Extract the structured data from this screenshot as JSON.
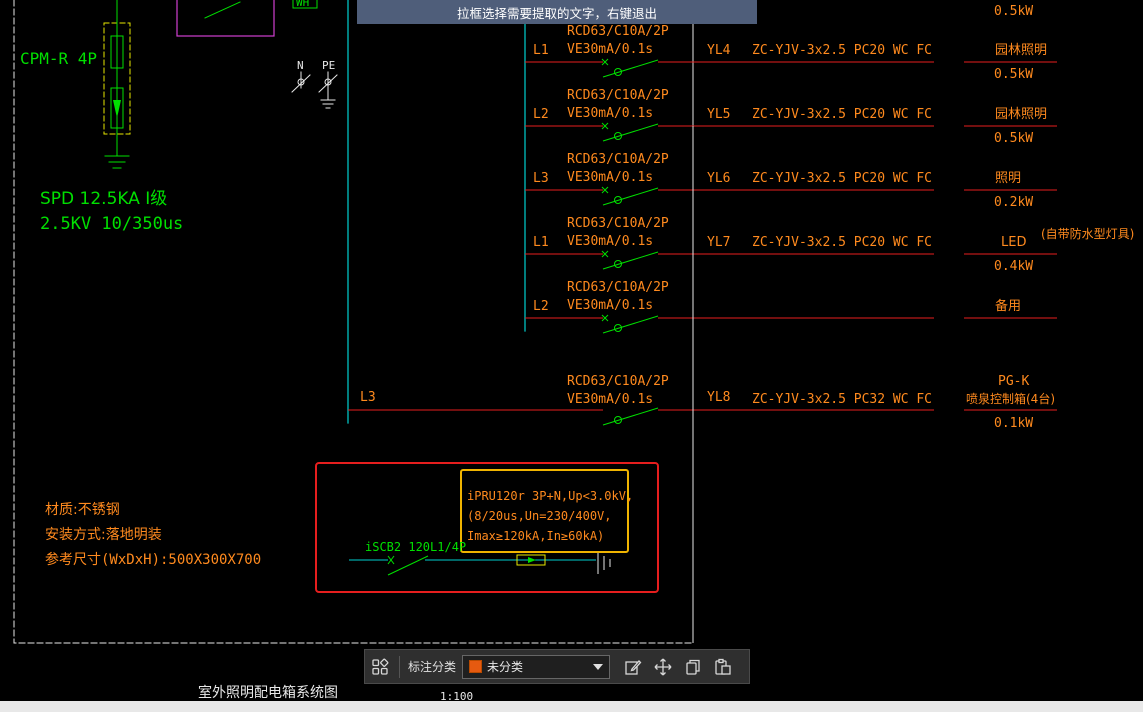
{
  "hint_bar": {
    "text": "拉框选择需要提取的文字，右键退出",
    "bg": "#4f5e7a"
  },
  "colors": {
    "green": "#00e000",
    "orange": "#ff8a1e",
    "red_line": "#e61e1e",
    "cyan_bus": "#00d0d0",
    "annot_red": "#e61e1e",
    "annot_yellow": "#f0b400",
    "category_swatch": "#e65a10"
  },
  "left": {
    "cpm": "CPM-R 4P",
    "spd_line1": "SPD 12.5KA I级",
    "spd_line2": "2.5KV 10/350us",
    "wh": "WH",
    "n": "N",
    "pe": "PE",
    "material": "材质:不锈钢",
    "install": "安装方式:落地明装",
    "size": "参考尺寸(WxDxH):500X300X700"
  },
  "top_power": "0.5kW",
  "circuits": [
    {
      "breaker1": "RCD63/C10A/2P",
      "breaker2": "VE30mA/0.1s",
      "phase": "L1",
      "id": "YL4",
      "cable": "ZC-YJV-3x2.5 PC20 WC FC",
      "load": "园林照明",
      "power": "0.5kW"
    },
    {
      "breaker1": "RCD63/C10A/2P",
      "breaker2": "VE30mA/0.1s",
      "phase": "L2",
      "id": "YL5",
      "cable": "ZC-YJV-3x2.5 PC20 WC FC",
      "load": "园林照明",
      "power": "0.5kW"
    },
    {
      "breaker1": "RCD63/C10A/2P",
      "breaker2": "VE30mA/0.1s",
      "phase": "L3",
      "id": "YL6",
      "cable": "ZC-YJV-3x2.5 PC20 WC FC",
      "load": "照明",
      "power": "0.2kW"
    },
    {
      "breaker1": "RCD63/C10A/2P",
      "breaker2": "VE30mA/0.1s",
      "phase": "L1",
      "id": "YL7",
      "cable": "ZC-YJV-3x2.5 PC20 WC FC",
      "load": "LED",
      "load_note": "(自带防水型灯具)",
      "power": "0.4kW"
    },
    {
      "breaker1": "RCD63/C10A/2P",
      "breaker2": "VE30mA/0.1s",
      "phase": "L2",
      "id": "",
      "cable": "",
      "load": "备用",
      "power": ""
    }
  ],
  "circuit_l3": {
    "breaker1": "RCD63/C10A/2P",
    "breaker2": "VE30mA/0.1s",
    "phase": "L3",
    "id": "YL8",
    "cable": "ZC-YJV-3x2.5 PC32 WC FC",
    "load1": "PG-K",
    "load2": "喷泉控制箱(4台)",
    "power": "0.1kW"
  },
  "spd_device": {
    "breaker": "iSCB2 120L1/4P",
    "line1": "iPRU120r 3P+N,Up<3.0kV,",
    "line2": "(8/20us,Un=230/400V,",
    "line3": "Imax≥120kA,In≥60kA)"
  },
  "drawing_title": "室外照明配电箱系统图",
  "scale": "1:100",
  "toolbar": {
    "label": "标注分类",
    "selected": "未分类"
  }
}
